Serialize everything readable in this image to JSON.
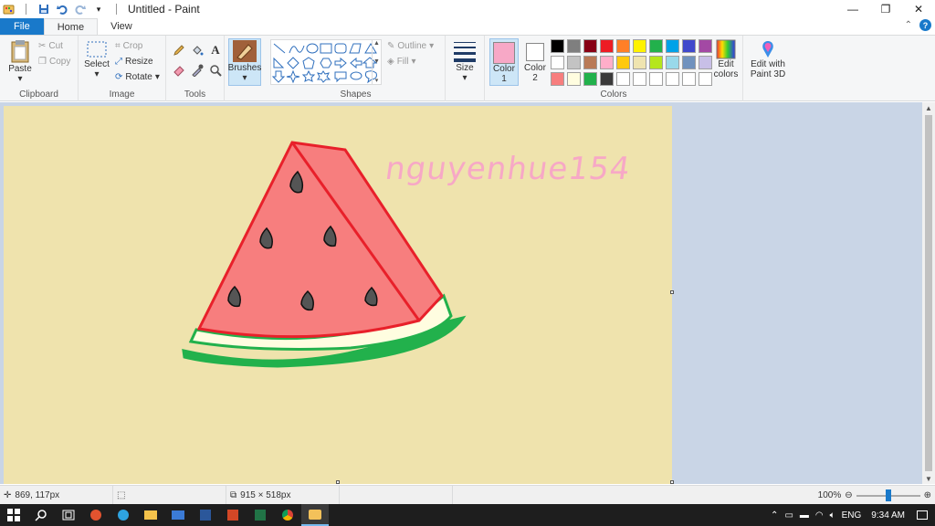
{
  "window": {
    "title": "Untitled - Paint"
  },
  "tabs": [
    "File",
    "Home",
    "View"
  ],
  "ribbon": {
    "clipboard": {
      "paste": "Paste",
      "cut": "Cut",
      "copy": "Copy",
      "label": "Clipboard"
    },
    "image": {
      "select": "Select",
      "crop": "Crop",
      "resize": "Resize",
      "rotate": "Rotate",
      "label": "Image"
    },
    "tools": {
      "label": "Tools",
      "brushes": "Brushes"
    },
    "shapes": {
      "outline": "Outline",
      "fill": "Fill",
      "label": "Shapes"
    },
    "size": {
      "label": "Size"
    },
    "colors": {
      "color1": "Color",
      "color1_num": "1",
      "color2": "Color",
      "color2_num": "2",
      "edit_colors_1": "Edit",
      "edit_colors_2": "colors",
      "edit_3d_1": "Edit with",
      "edit_3d_2": "Paint 3D",
      "label": "Colors",
      "color1_value": "#f7a8c6",
      "color2_value": "#ffffff",
      "palette": [
        "#000000",
        "#7f7f7f",
        "#880015",
        "#ed1c24",
        "#ff7f27",
        "#fff200",
        "#22b14c",
        "#00a2e8",
        "#3f48cc",
        "#a349a4",
        "#ffffff",
        "#c3c3c3",
        "#b97a57",
        "#ffaec9",
        "#ffc90e",
        "#efe4b0",
        "#b5e61d",
        "#99d9ea",
        "#7092be",
        "#c8bfe7",
        "#f77e7e",
        "#fffde0",
        "#22b14c",
        "#3a3a3a",
        "#ffffff",
        "#ffffff",
        "#ffffff",
        "#ffffff",
        "#ffffff",
        "#ffffff"
      ]
    }
  },
  "canvas": {
    "background": "#efe3ad",
    "signature": "nguyenhue154"
  },
  "status": {
    "cursor": "869, 117px",
    "canvas_size": "915 × 518px",
    "zoom": "100%"
  },
  "taskbar": {
    "language": "ENG",
    "time": "9:34 AM"
  }
}
